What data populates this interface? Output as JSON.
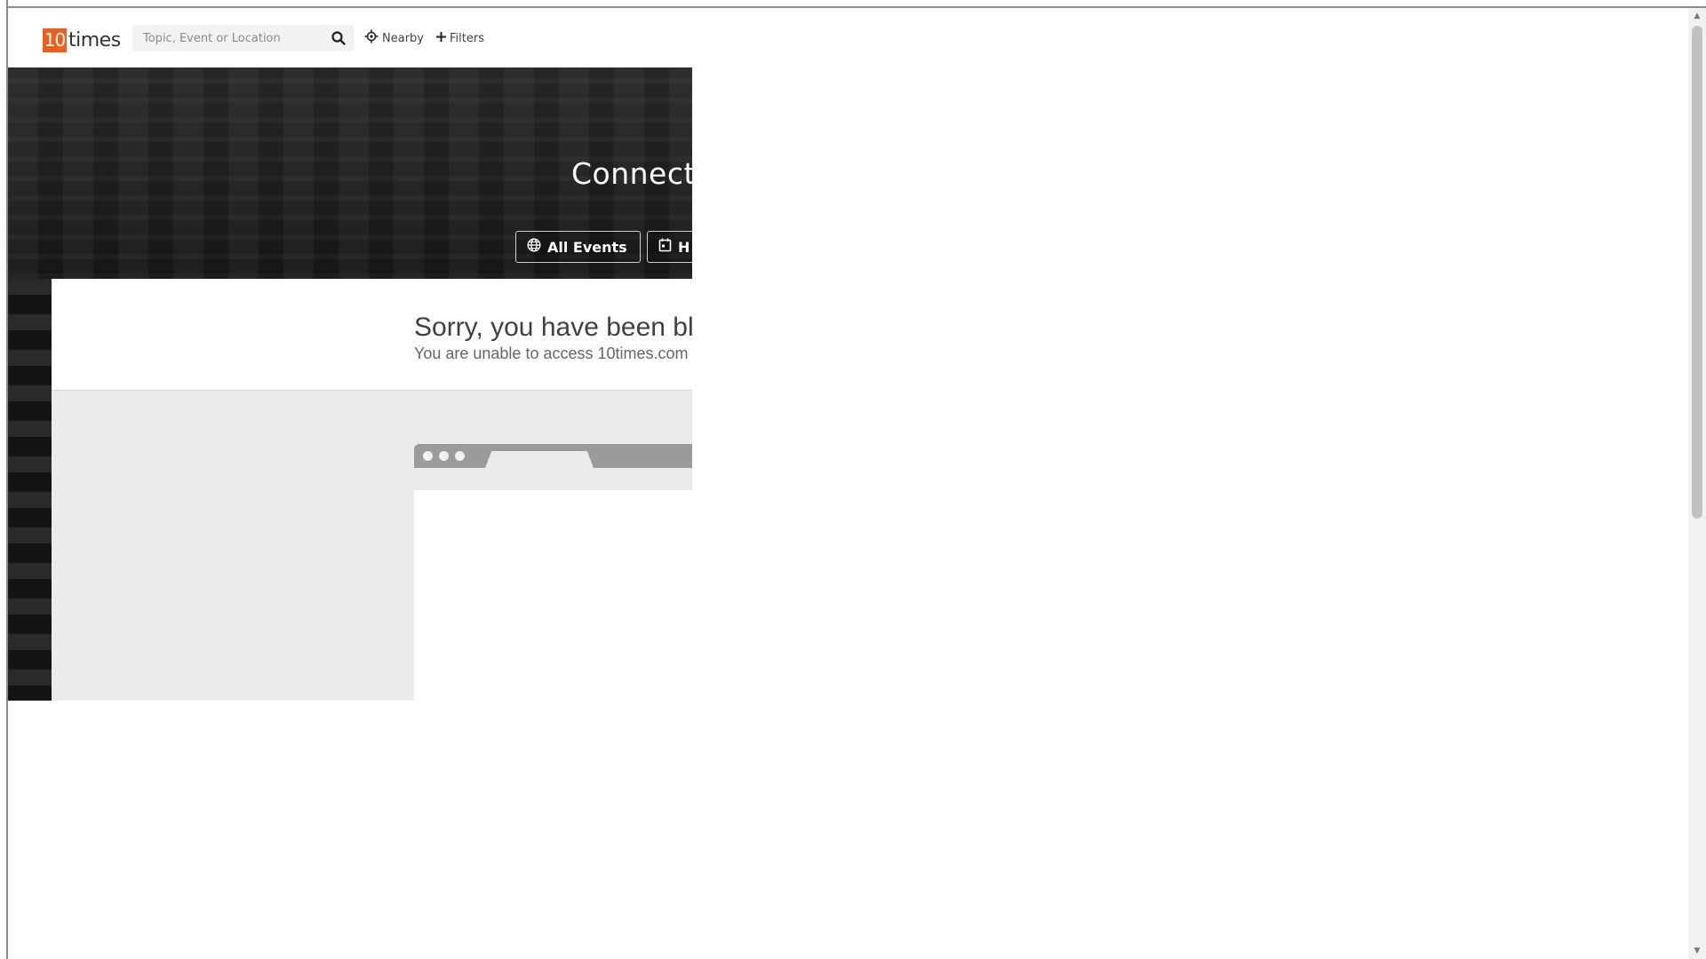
{
  "header": {
    "logo": {
      "number": "10",
      "text": "times"
    },
    "search": {
      "placeholder": "Topic, Event or Location"
    },
    "nearby_label": "Nearby",
    "filters_label": "Filters"
  },
  "hero": {
    "title": "Connect",
    "buttons": [
      {
        "label": "All Events",
        "icon": "globe-icon"
      },
      {
        "label": "H",
        "icon": "calendar-icon"
      }
    ]
  },
  "block": {
    "title": "Sorry, you have been blo",
    "subtitle": "You are unable to access 10times.com"
  },
  "colors": {
    "brand": "#f25c19",
    "hero_bg": "#1d1d1d",
    "panel_bg": "#ebebeb",
    "browser_bar": "#9b9b9b"
  }
}
